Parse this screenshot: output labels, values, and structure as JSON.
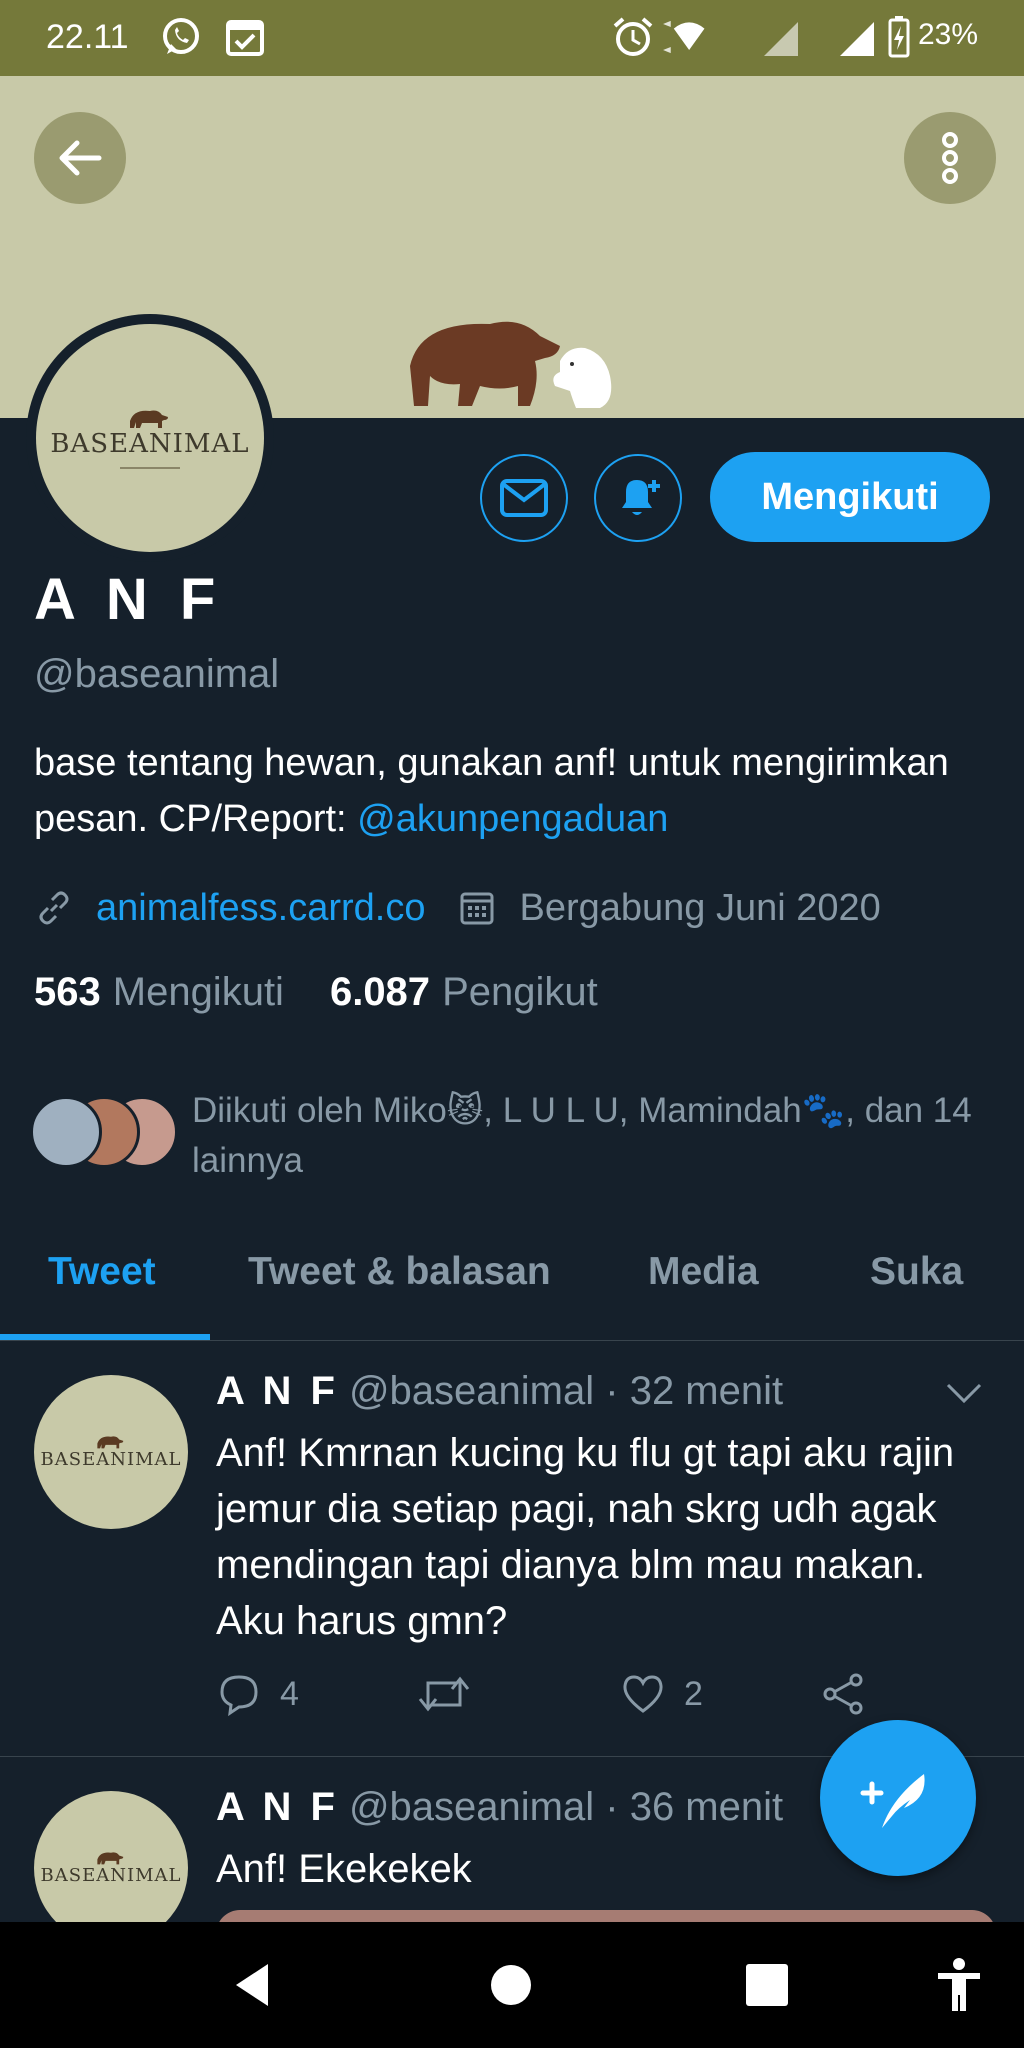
{
  "status_bar": {
    "time": "22.11",
    "battery": "23%",
    "icons": [
      "whatsapp-icon",
      "calendar-check-icon",
      "alarm-icon",
      "wifi-icon",
      "signal-icon",
      "signal-icon",
      "battery-charging-icon"
    ]
  },
  "header": {
    "back_icon": "arrow-left-icon",
    "menu_icon": "more-vertical-icon"
  },
  "profile": {
    "avatar_logo_text": "BASEANIMAL",
    "display_name": "A N F",
    "handle": "@baseanimal",
    "bio_text": "base tentang hewan, gunakan anf! untuk mengirimkan pesan. CP/Report: ",
    "bio_mention": "@akunpengaduan",
    "website": "animalfess.carrd.co",
    "joined": "Bergabung Juni 2020",
    "following_count": "563",
    "following_label": "Mengikuti",
    "followers_count": "6.087",
    "followers_label": "Pengikut",
    "follow_button": "Mengikuti",
    "followed_by": "Diikuti oleh Miko😾, L U L U, Mamindah🐾, dan 14 lainnya"
  },
  "tabs": [
    {
      "label": "Tweet",
      "active": true
    },
    {
      "label": "Tweet & balasan",
      "active": false
    },
    {
      "label": "Media",
      "active": false
    },
    {
      "label": "Suka",
      "active": false
    }
  ],
  "tweets": [
    {
      "name": "A N F",
      "handle": "@baseanimal",
      "time": "· 32 menit",
      "text": "Anf! Kmrnan kucing ku flu gt tapi aku rajin jemur dia setiap pagi, nah skrg udh agak mendingan tapi dianya blm mau makan. Aku harus gmn?",
      "replies": "4",
      "likes": "2"
    },
    {
      "name": "A N F",
      "handle": "@baseanimal",
      "time": "· 36 menit",
      "text": "Anf! Ekekekek"
    }
  ],
  "colors": {
    "background": "#15202b",
    "accent": "#1da1f2",
    "muted": "#8899a6",
    "status_bar": "#75793a",
    "banner": "#c8c9a8"
  }
}
